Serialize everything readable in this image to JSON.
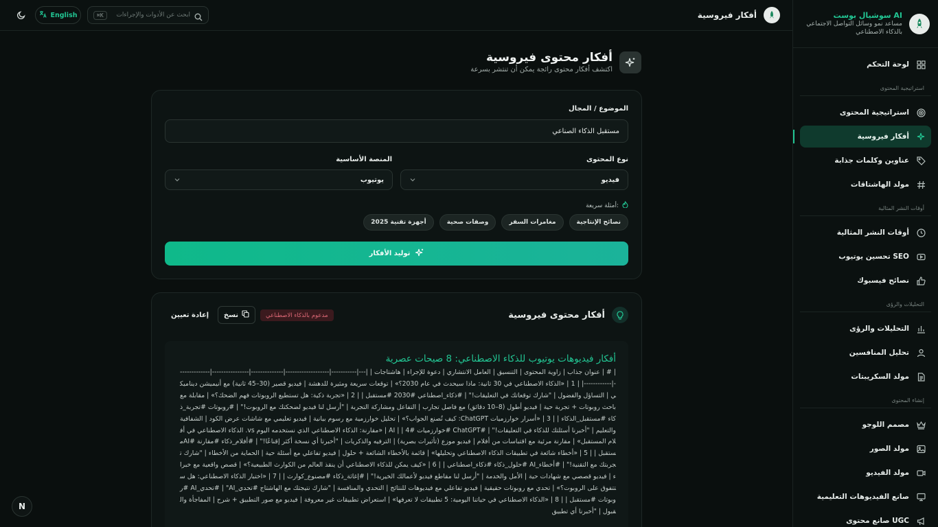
{
  "topbar": {
    "title": "أفكار فيروسية",
    "lang_label": "English",
    "search_placeholder": "ابحث عن الأدوات والإجراءات",
    "search_shortcut": "⌘K"
  },
  "sidebar": {
    "brand_name": "سوشيال بوست AI",
    "brand_tagline_1": "مساعد نمو وسائل التواصل الاجتماعي",
    "brand_tagline_2": "بالذكاء الاصطناعي",
    "dashboard": "لوحة التحكم",
    "sec_strategy": "استراتيجية المحتوى",
    "content_strategy": "استراتيجية المحتوى",
    "viral_ideas": "أفكار فيروسية",
    "headlines": "عناوين وكلمات جذابة",
    "hashtag_gen": "مولد الهاشتاقات",
    "sec_times": "أوقات النشر المثالية",
    "best_times": "أوقات النشر المثالية",
    "youtube_seo": "تحسين يوتيوب SEO",
    "facebook_tips": "نصائح فيسبوك",
    "sec_analytics": "التحليلات والرؤى",
    "analytics": "التحليلات والرؤى",
    "competitors": "تحليل المنافسين",
    "scripts": "مولد السكريبتات",
    "sec_create": "إنشاء المحتوى",
    "logo_designer": "مصمم اللوجو",
    "image_gen": "مولد الصور",
    "video_gen": "مولد الفيديو",
    "edu_video": "صانع الفيديوهات التعليمية",
    "ugc": "صانع محتوى UGC"
  },
  "page": {
    "title": "أفكار محتوى فيروسية",
    "subtitle": "اكتشف أفكار محتوى رائجة يمكن أن تنتشر بسرعة"
  },
  "form": {
    "topic_label": "الموضوع / المجال",
    "topic_value": "مستقبل الذكاء الصناعي",
    "content_type_label": "نوع المحتوى",
    "content_type_value": "فيديو",
    "platform_label": "المنصة الأساسية",
    "platform_value": "يوتيوب",
    "quick_label": "أمثلة سريعة:",
    "chips": [
      "نصائح الإنتاجية",
      "مغامرات السفر",
      "وصفات صحية",
      "أجهزة تقنية 2025"
    ],
    "generate_label": "توليد الأفكار"
  },
  "result": {
    "title": "أفكار محتوى فيروسية",
    "ai_badge": "مدعوم بالذكاء الاصطناعي",
    "copy_label": "نسخ",
    "reset_label": "إعادة تعيين",
    "heading": "أفكار فيديوهات يوتيوب للذكاء الاصطناعي: 8 صيحات عصرية",
    "text": "| # | عنوان جذاب | زاوية المحتوى | التنسيق | العامل الانتشاري | دعوة للإجراء | هاشتاجات | |---|-----------|-------------------|--------------|----------------|--------------|------------| | 1 | «الذكاء الاصطناعي في 30 ثانية: ماذا سيحدث في عام 2030؟» | توقعات سريعة ومثيرة للدهشة | فيديو قصير (30–45 ثانية) مع أنيميشن ديناميكي | التساؤل والفضول | \"شارك توقعاتك في التعليقات!\" | #ذكاء_اصطناعي #2030 #مستقبل | | 2 | «تجربة ذكية: هل تستطيع الروبوتات فهم الضحك؟» | مقابلة مع باحث روبوتات + تجربة حية | فيديو أطول (8–10 دقائق) مع فاصل تجارب | التفاعل ومشاركة التجربة | \"أرسل لنا فيديو لضحكتك مع الروبوت!\" | #روبوتات #تجربة_ذكاء #مستقبل_الذكاء | | 3 | «أسرار خوارزميات ChatGPT: كيف تُصنع الجواب؟» | تحليل خوارزمية مع رسوم بيانية | فيديو تعليمي مع شاشات عرض الكود | الشفافية والتعليم | \"أخبرنا أسئلتك للذكاء في التعليقات!\" | #ChatGPT #خوارزميات #AI | | 4 | «مقارنة: الذكاء الاصطناعي الذي نستخدمه اليوم vs. الذكاء الاصطناعي في أفلام المستقبل» | مقارنة مرئية مع اقتباسات من أفلام | فيديو موزع (تأثيرات بصرية) | الترفيه والذكريات | \"أخبرنا أي نسخة أكثر إقناعًا!\" | #أفلام_ذكاء #مقارنة #AIمستقبل | | 5 | «أخطاء شائعة في تطبيقات الذكاء الاصطناعي وتحليلها» | قائمة بالأخطاء الشائعة + حلول | فيديو تفاعلي مع أسئلة حية | الحماية من الأخطاء | \"شارك تجربتك مع التقنية!\" | #أخطاء_AI #حلول_ذكاء #ذكاء_اصطناعي | | 6 | «كيف يمكن للذكاء الاصطناعي أن ينقذ العالم من الكوارث الطبيعية؟» | قصص واقعية مع خبراء | فيديو قصصي مع شهادات حية | الأمل والخدمة | \"أرسل لنا مقاطع فيديو لأعمالك الخيرية!\" | #إغاثة_ذكاء #مصنوع_كوارث | | 7 | «اختبار الذكاء الاصطناعي: هل ستتفوق على الروبوت؟» | تحدي مع روبوتات حقيقية | فيديو تفاعلي مع فيديوهات للنتائج | التحدي والمنافسة | \"شارك نتيجتك مع الهاشتاج #تحدي_AI\" | #تحدي_AI #روبوتات #مستقبل | | 8 | «الذكاء الاصطناعي في حياتنا اليومية: 5 تطبيقات لا تعرفها» | استعراض تطبيقات غير معروفة | فيديو مع صور التطبيق + شرح | المفاجأة والقبول | \"أخبرنا أي تطبيق"
  }
}
